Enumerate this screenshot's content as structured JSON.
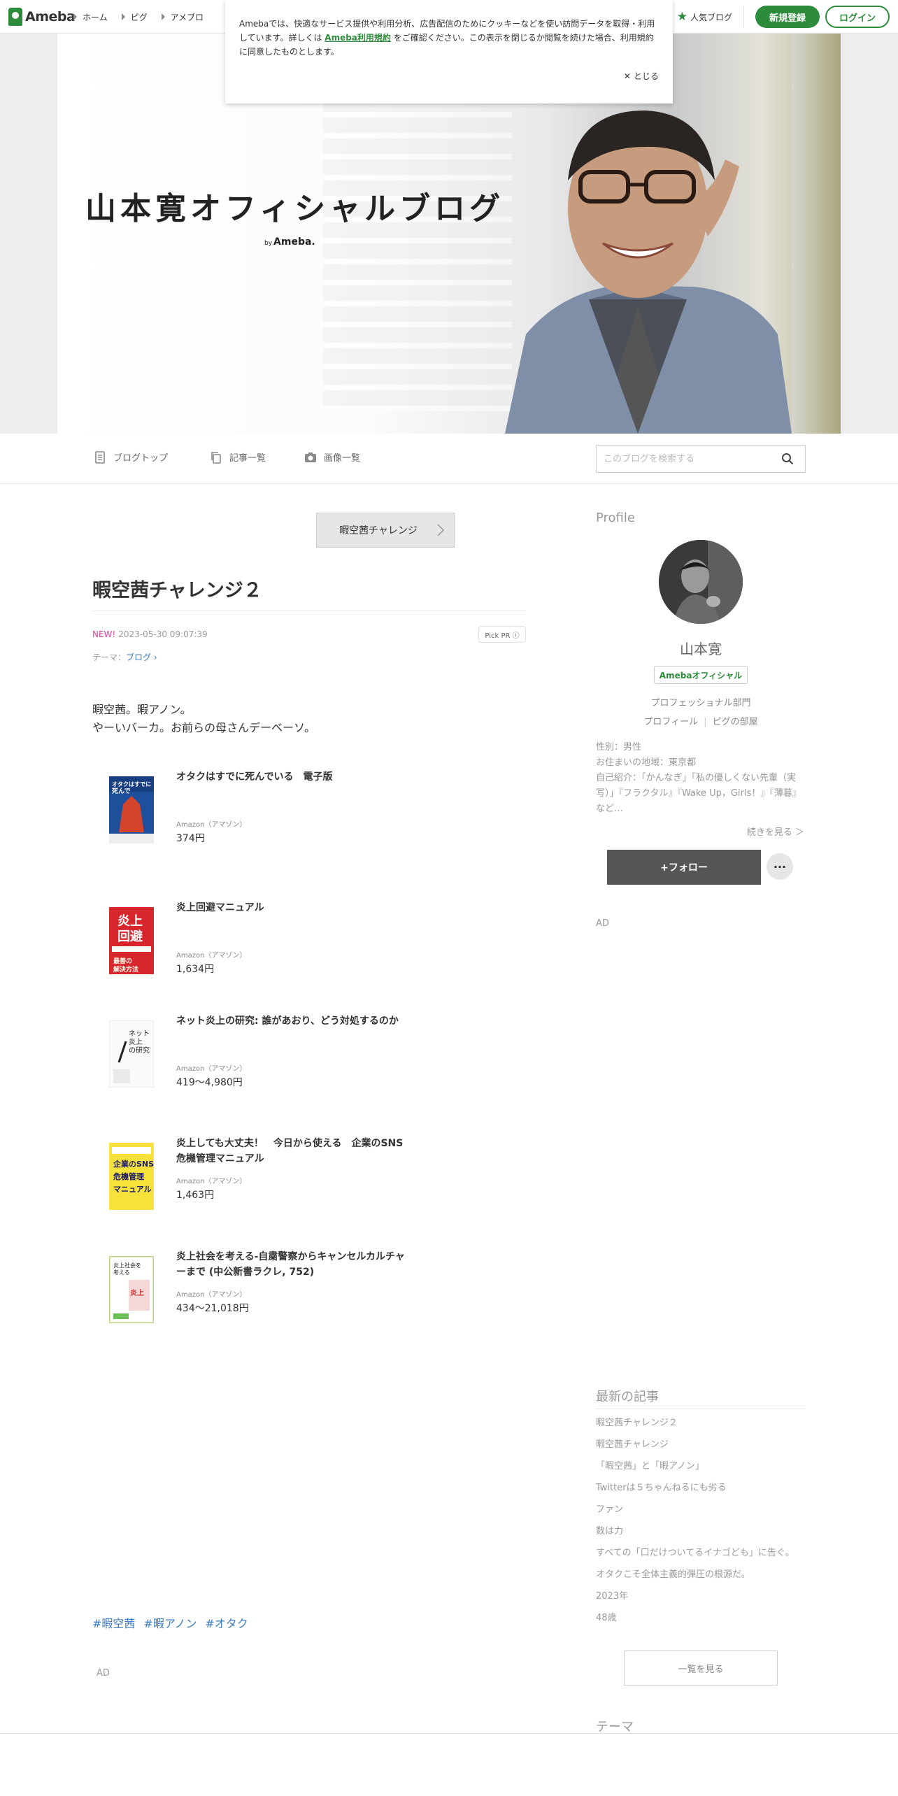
{
  "topbar": {
    "logo": "Ameba",
    "nav": [
      "ホーム",
      "ピグ",
      "アメブロ"
    ],
    "popular_blog": "人気ブログ",
    "register": "新規登録",
    "login": "ログイン"
  },
  "cookie": {
    "text_before": "Amebaでは、快適なサービス提供や利用分析、広告配信のためにクッキーなどを使い訪問データを取得・利用しています。詳しくは",
    "link": "Ameba利用規約",
    "text_after": "をご確認ください。この表示を閉じるか閲覧を続けた場合、利用規約に同意したものとします。",
    "close": "とじる"
  },
  "hero": {
    "title": "山本寛オフィシャルブログ",
    "by_small": "by",
    "by_brand": "Ameba."
  },
  "blognav": {
    "top": "ブログトップ",
    "entries": "記事一覧",
    "images": "画像一覧",
    "search_placeholder": "このブログを検索する"
  },
  "article": {
    "theme_button": "暇空茜チャレンジ",
    "title": "暇空茜チャレンジ２",
    "new_label": "NEW!",
    "date": "2023-05-30 09:07:39",
    "pickpr": "Pick PR ⓘ",
    "theme_label": "テーマ：",
    "theme_value": "ブログ",
    "body_line1": "暇空茜。暇アノン。",
    "body_line2": "やーいバーカ。お前らの母さんデーベーソ。",
    "items": [
      {
        "title": "オタクはすでに死んでいる　電子版",
        "source": "Amazon（アマゾン）",
        "price": "374円"
      },
      {
        "title": "炎上回避マニュアル",
        "source": "Amazon（アマゾン）",
        "price": "1,634円"
      },
      {
        "title": "ネット炎上の研究: 誰があおり、どう対処するのか",
        "source": "Amazon（アマゾン）",
        "price": "419〜4,980円"
      },
      {
        "title": "炎上しても大丈夫！　今日から使える　企業のSNS危機管理マニュアル",
        "source": "Amazon（アマゾン）",
        "price": "1,463円"
      },
      {
        "title": "炎上社会を考える-自粛警察からキャンセルカルチャーまで (中公新書ラクレ, 752)",
        "source": "Amazon（アマゾン）",
        "price": "434〜21,018円"
      }
    ],
    "tags": [
      "#暇空茜",
      "#暇アノン",
      "#オタク"
    ],
    "ad": "AD"
  },
  "sidebar": {
    "profile_heading": "Profile",
    "name": "山本寛",
    "official_badge": "Amebaオフィシャル",
    "department": "プロフェッショナル部門",
    "profile_link": "プロフィール",
    "pigg_room": "ピグの部屋",
    "info_gender": "性別：男性",
    "info_location": "お住まいの地域：東京都",
    "info_intro": "自己紹介：「かんなぎ」「私の優しくない先輩（実写）」『フラクタル』『Wake Up，Girls！』『薄暮』など…",
    "more": "続きを見る ＞",
    "follow": "+フォロー",
    "menu": "···",
    "ad": "AD",
    "latest_heading": "最新の記事",
    "latest": [
      "暇空茜チャレンジ２",
      "暇空茜チャレンジ",
      "「暇空茜」と「暇アノン」",
      "Twitterは５ちゃんねるにも劣る",
      "ファン",
      "数は力",
      "すべての「口だけついてるイナゴども」に告ぐ。",
      "オタクこそ全体主義的弾圧の根源だ。",
      "2023年",
      "48歳"
    ],
    "list_all": "一覧を見る",
    "theme_heading": "テーマ"
  }
}
